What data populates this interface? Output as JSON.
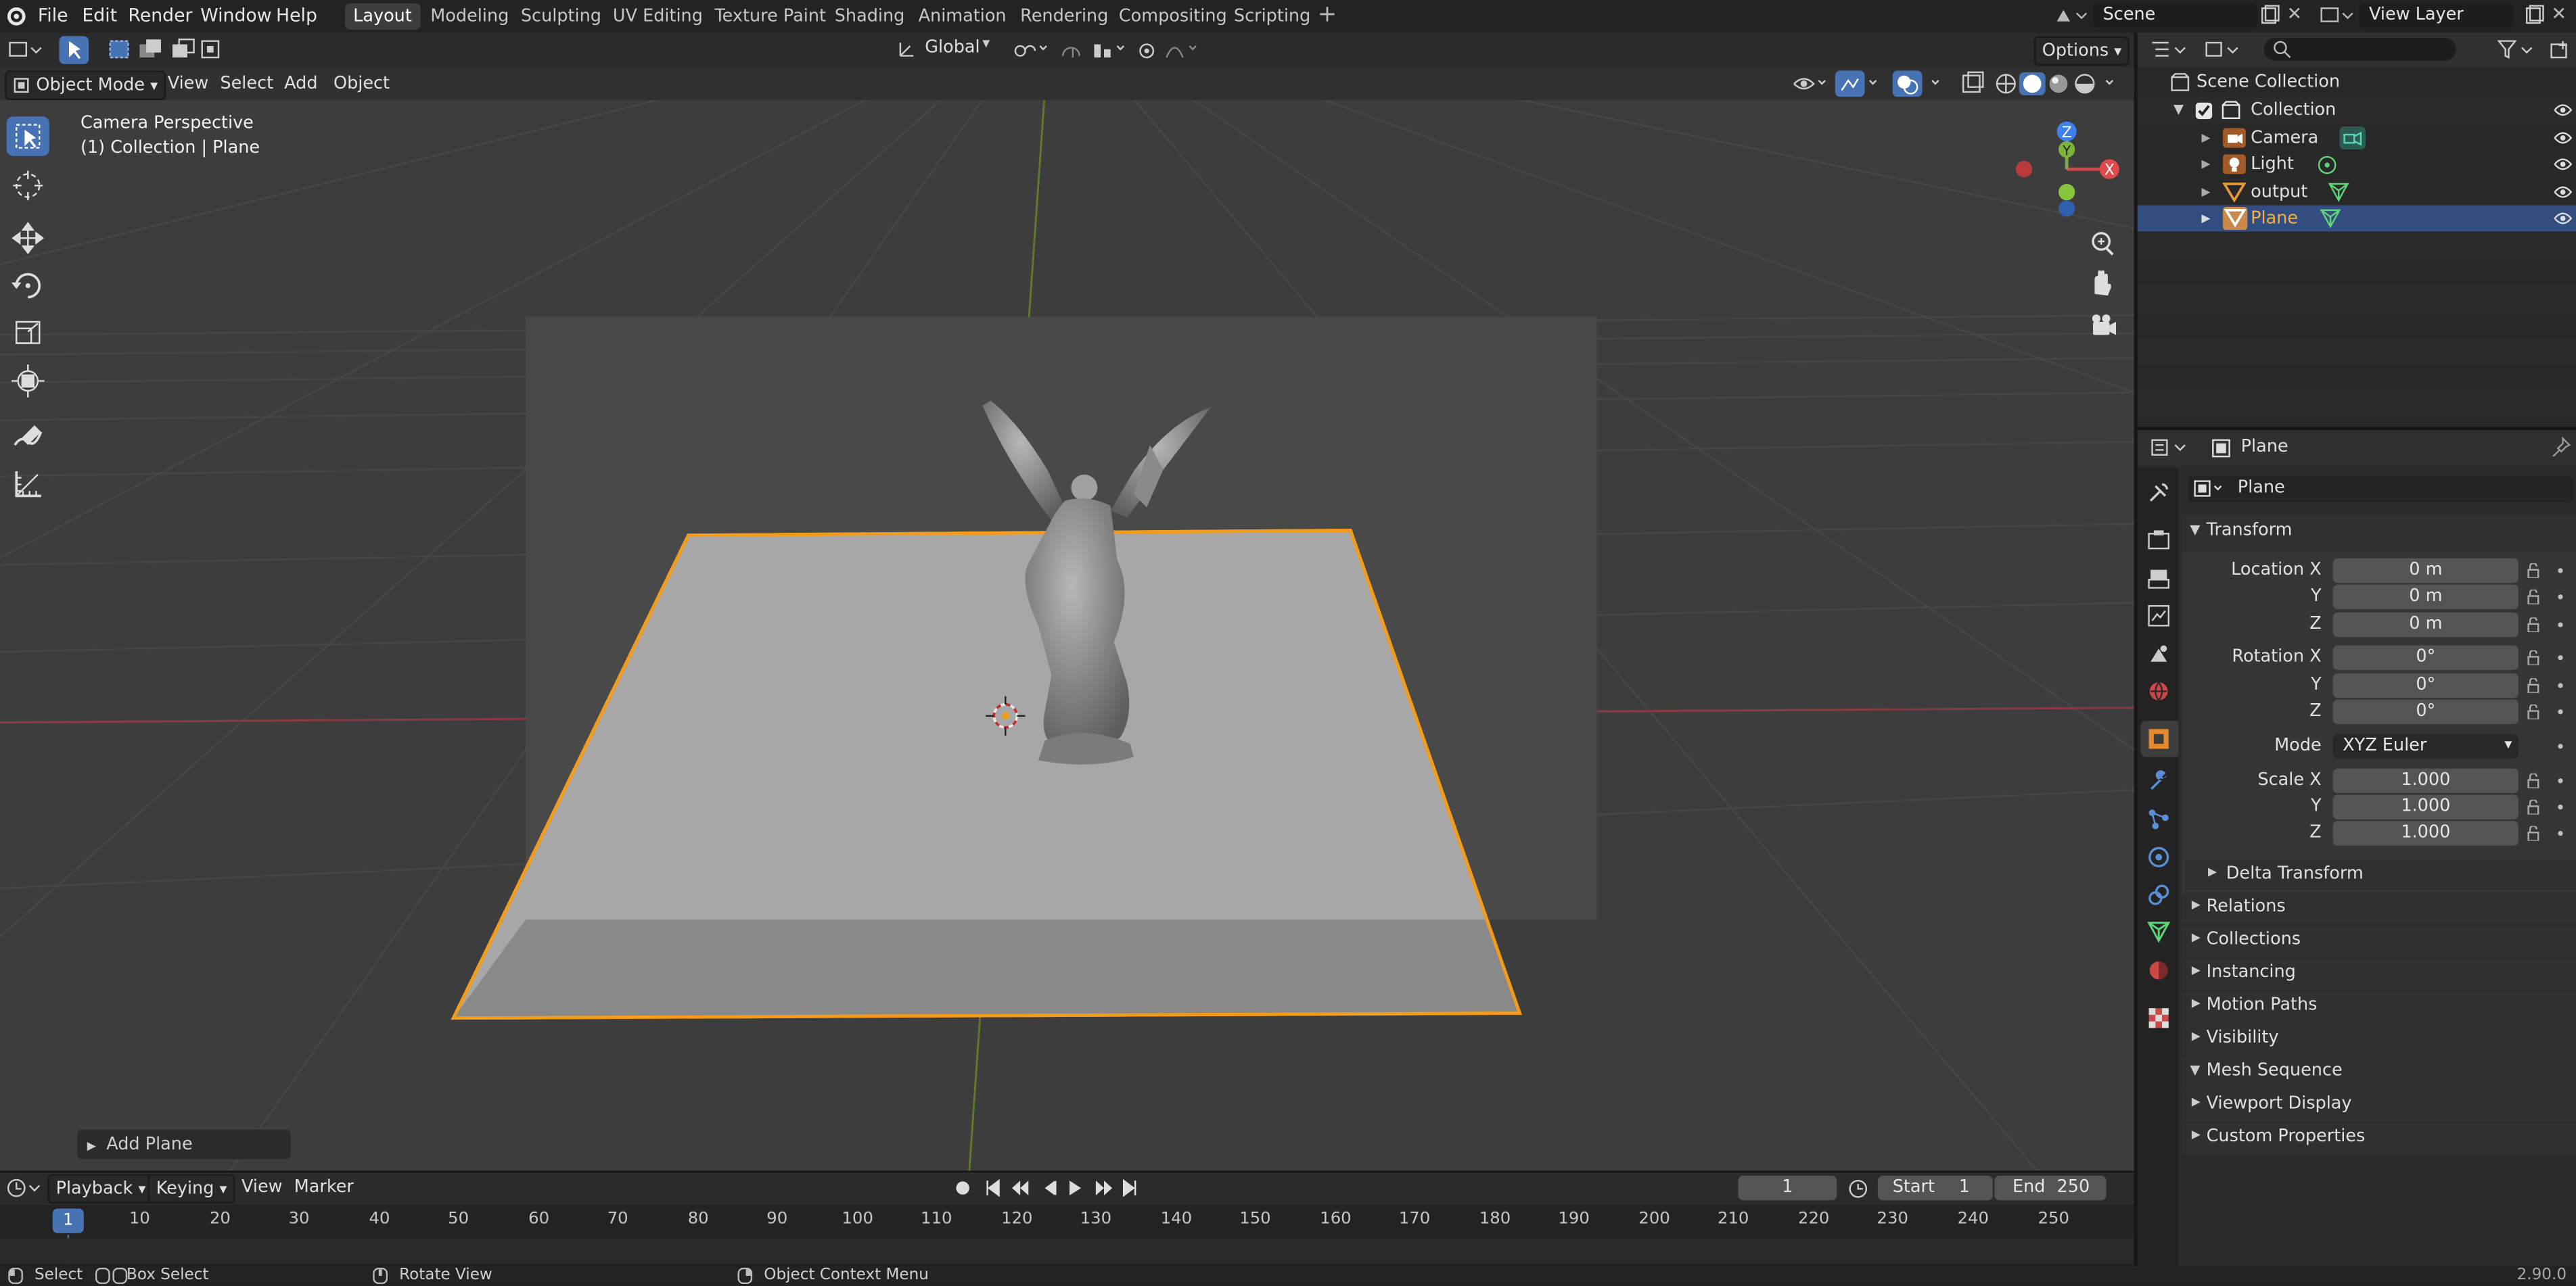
{
  "menu": [
    "File",
    "Edit",
    "Render",
    "Window",
    "Help"
  ],
  "workspaces": [
    "Layout",
    "Modeling",
    "Sculpting",
    "UV Editing",
    "Texture Paint",
    "Shading",
    "Animation",
    "Rendering",
    "Compositing",
    "Scripting"
  ],
  "scene_name": "Scene",
  "view_layer": "View Layer",
  "tool_header": {
    "orientation": "Global",
    "options": "Options"
  },
  "viewport_header": {
    "mode": "Object Mode",
    "menus": [
      "View",
      "Select",
      "Add",
      "Object"
    ]
  },
  "viewport_overlay": {
    "line1": "Camera Perspective",
    "line2": "(1) Collection | Plane"
  },
  "last_operator": "Add Plane",
  "gizmo": {
    "x": "X",
    "y": "Y",
    "z": "Z"
  },
  "outliner": {
    "root": "Scene Collection",
    "collection": "Collection",
    "items": [
      {
        "name": "Camera",
        "icon": "camera-icon"
      },
      {
        "name": "Light",
        "icon": "light-icon"
      },
      {
        "name": "output",
        "icon": "mesh-icon"
      },
      {
        "name": "Plane",
        "icon": "mesh-icon",
        "selected": true
      }
    ]
  },
  "properties": {
    "header": "Plane",
    "object_name": "Plane",
    "transform_label": "Transform",
    "location": {
      "label": "Location X",
      "x": "0 m",
      "y": "0 m",
      "z": "0 m"
    },
    "rotation": {
      "label": "Rotation X",
      "x": "0°",
      "y": "0°",
      "z": "0°"
    },
    "mode_label": "Mode",
    "mode_value": "XYZ Euler",
    "scale": {
      "label": "Scale X",
      "x": "1.000",
      "y": "1.000",
      "z": "1.000"
    },
    "axis_y": "Y",
    "axis_z": "Z",
    "delta": "Delta Transform",
    "panels": [
      "Relations",
      "Collections",
      "Instancing",
      "Motion Paths",
      "Visibility",
      "Mesh Sequence",
      "Viewport Display",
      "Custom Properties"
    ]
  },
  "timeline": {
    "menus": [
      "Playback",
      "Keying",
      "View",
      "Marker"
    ],
    "current_frame": "1",
    "start_label": "Start",
    "start": "1",
    "end_label": "End",
    "end": "250",
    "ticks": [
      "10",
      "20",
      "30",
      "40",
      "50",
      "60",
      "70",
      "80",
      "90",
      "100",
      "110",
      "120",
      "130",
      "140",
      "150",
      "160",
      "170",
      "180",
      "190",
      "200",
      "210",
      "220",
      "230",
      "240",
      "250"
    ],
    "playhead": "1"
  },
  "statusbar": {
    "select": "Select",
    "box_select": "Box Select",
    "rotate_view": "Rotate View",
    "context_menu": "Object Context Menu",
    "version": "2.90.0"
  },
  "colors": {
    "selection_outline": "#f39c1c",
    "active_tab": "#4772b3",
    "header_bg": "#303030",
    "viewport_bg": "#3d3d3d"
  }
}
